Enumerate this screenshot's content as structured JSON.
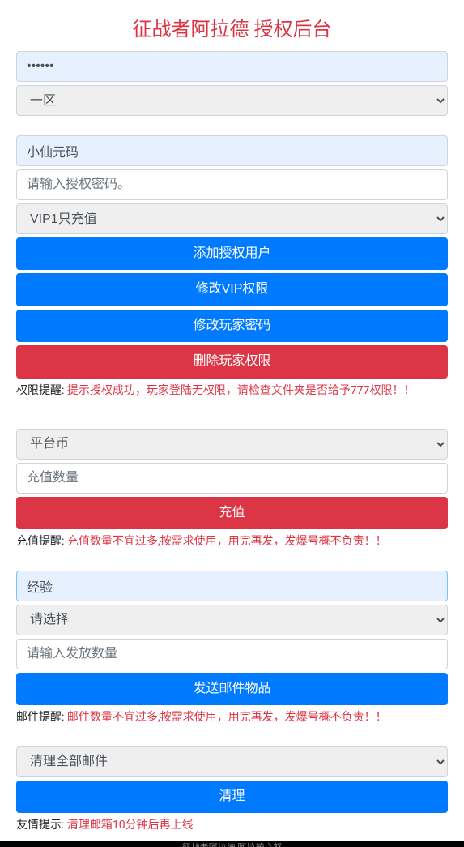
{
  "page_title": "征战者阿拉德 授权后台",
  "login": {
    "password_value": "••••••",
    "zone_selected": "一区"
  },
  "auth_section": {
    "username_value": "小仙元码",
    "password_placeholder": "请输入授权密码。",
    "vip_selected": "VIP1只充值",
    "btn_add": "添加授权用户",
    "btn_modify_vip": "修改VIP权限",
    "btn_modify_pw": "修改玩家密码",
    "btn_delete": "删除玩家权限",
    "tip_prefix": "权限提醒: ",
    "tip_text": "提示授权成功，玩家登陆无权限，请检查文件夹是否给予777权限！！"
  },
  "recharge_section": {
    "currency_selected": "平台币",
    "amount_placeholder": "充值数量",
    "btn_recharge": "充值",
    "tip_prefix": "充值提醒: ",
    "tip_text": "充值数量不宜过多,按需求使用，用完再发，发爆号概不负责！！"
  },
  "mail_section": {
    "exp_value": "经验",
    "select_placeholder": "请选择",
    "amount_placeholder": "请输入发放数量",
    "btn_send": "发送邮件物品",
    "tip_prefix": "邮件提醒: ",
    "tip_text": "邮件数量不宜过多,按需求使用，用完再发，发爆号概不负责！！"
  },
  "clean_section": {
    "option_selected": "清理全部邮件",
    "btn_clean": "清理",
    "tip_prefix": "友情提示: ",
    "tip_text": "清理邮箱10分钟后再上线"
  },
  "footer_text": "征战者阿拉德 阿拉德之怒"
}
